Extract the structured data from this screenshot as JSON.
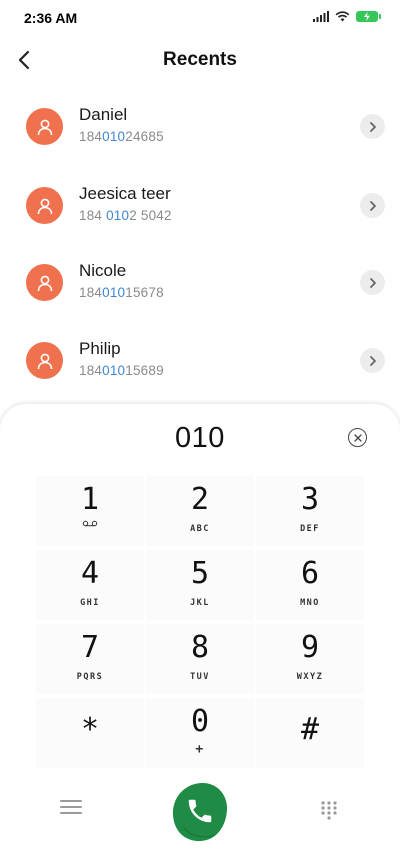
{
  "status_bar": {
    "time": "2:36 AM"
  },
  "header": {
    "title": "Recents"
  },
  "recents": [
    {
      "name": "Daniel",
      "number_parts": [
        "184",
        "010",
        "24685"
      ]
    },
    {
      "name": "Jeesica teer",
      "number_parts": [
        "184 ",
        "010",
        "2 5042"
      ]
    },
    {
      "name": "Nicole",
      "number_parts": [
        "184",
        "010",
        "15678"
      ]
    },
    {
      "name": "Philip",
      "number_parts": [
        "184",
        "010",
        "15689"
      ]
    }
  ],
  "dialer": {
    "number": "010",
    "keys": [
      {
        "digit": "1",
        "letters": "○_○"
      },
      {
        "digit": "2",
        "letters": "ABC"
      },
      {
        "digit": "3",
        "letters": "DEF"
      },
      {
        "digit": "4",
        "letters": "GHI"
      },
      {
        "digit": "5",
        "letters": "JKL"
      },
      {
        "digit": "6",
        "letters": "MNO"
      },
      {
        "digit": "7",
        "letters": "PQRS"
      },
      {
        "digit": "8",
        "letters": "TUV"
      },
      {
        "digit": "9",
        "letters": "WXYZ"
      },
      {
        "digit": "*",
        "letters": ""
      },
      {
        "digit": "0",
        "letters": "+"
      },
      {
        "digit": "#",
        "letters": ""
      }
    ]
  },
  "colors": {
    "avatar": "#f0714e",
    "highlight": "#3e86d6",
    "call_button": "#1f8b45",
    "battery": "#35c759"
  },
  "icons": {
    "back": "chevron-left-icon",
    "detail": "chevron-right-icon",
    "clear": "close-circle-icon",
    "menu": "menu-icon",
    "call": "phone-icon",
    "dialpad": "dialpad-icon"
  }
}
